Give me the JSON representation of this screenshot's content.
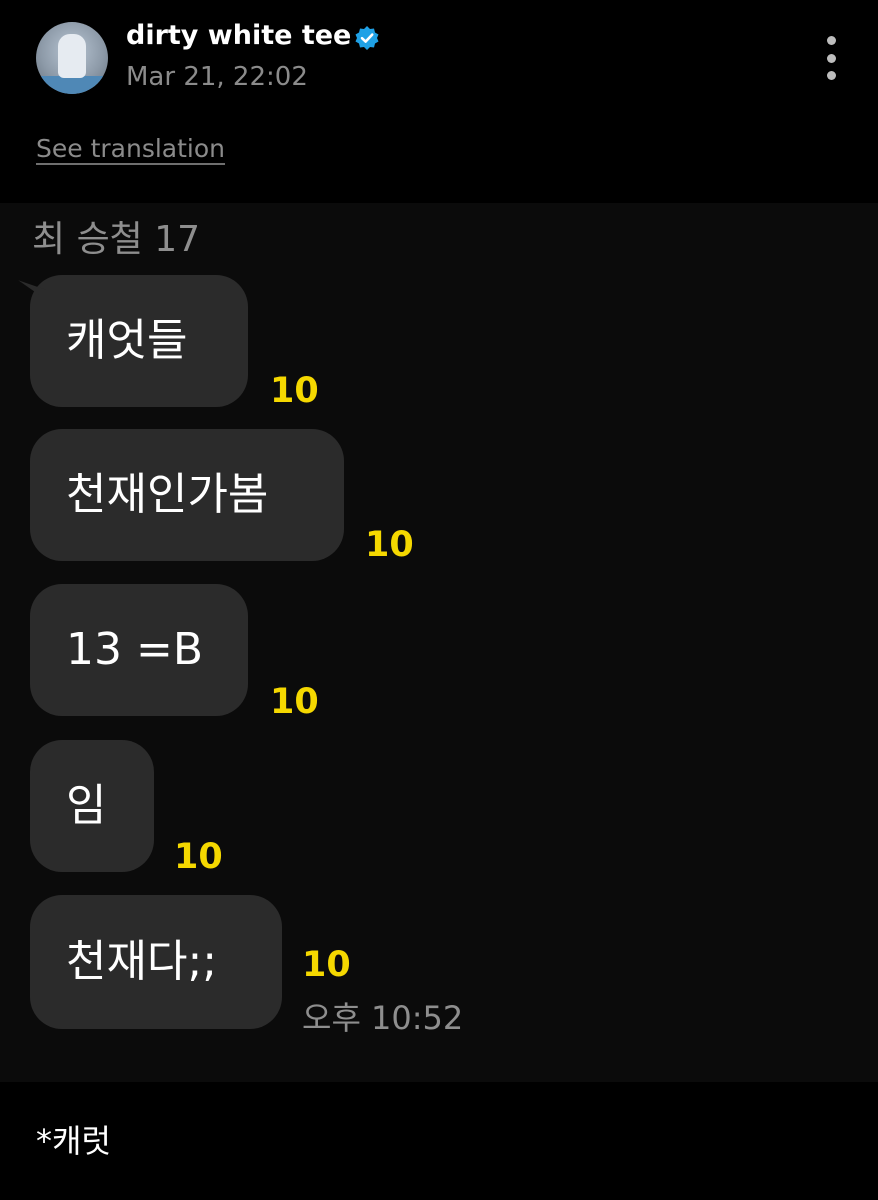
{
  "post": {
    "username": "dirty white tee",
    "timestamp": "Mar 21, 22:02",
    "see_translation": "See translation",
    "caption": "*캐럿",
    "icons": {
      "verified": "verified-badge-icon",
      "more": "more-options-icon"
    },
    "colors": {
      "verified": "#1fa1e6",
      "unread": "#f5d800"
    }
  },
  "chat": {
    "sender": "최 승철 17",
    "messages": [
      {
        "text": "캐엇들",
        "unread": "10"
      },
      {
        "text": "천재인가봄",
        "unread": "10"
      },
      {
        "text": "13 =B",
        "unread": "10"
      },
      {
        "text": "임",
        "unread": "10"
      },
      {
        "text": "천재다;;",
        "unread": "10",
        "time": "오후 10:52"
      }
    ]
  }
}
